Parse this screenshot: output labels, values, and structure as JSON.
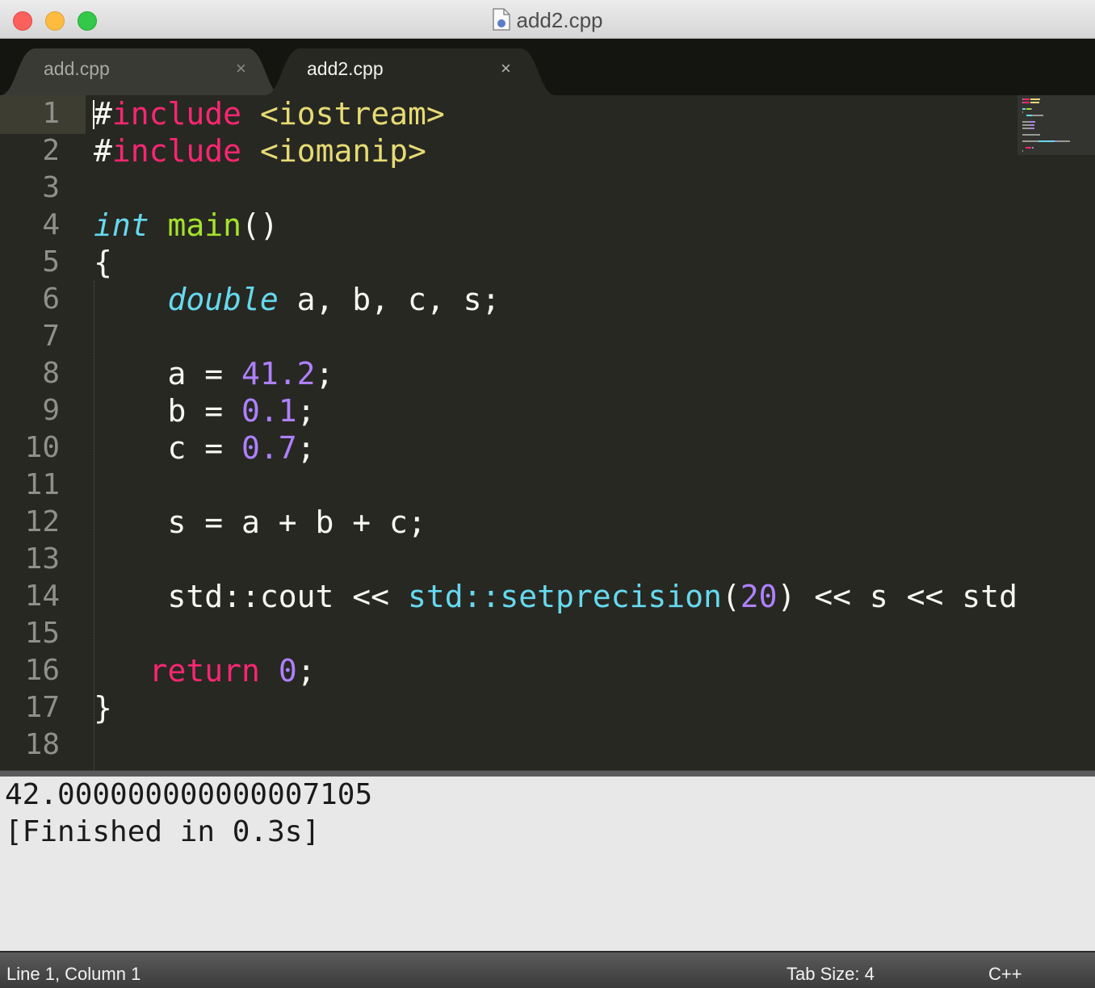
{
  "window": {
    "title": "add2.cpp"
  },
  "tabs": [
    {
      "label": "add.cpp",
      "close": "×",
      "active": false
    },
    {
      "label": "add2.cpp",
      "close": "×",
      "active": true
    }
  ],
  "editor": {
    "line_numbers": [
      "1",
      "2",
      "3",
      "4",
      "5",
      "6",
      "7",
      "8",
      "9",
      "10",
      "11",
      "12",
      "13",
      "14",
      "15",
      "16",
      "17",
      "18"
    ],
    "lines": [
      [
        {
          "t": "#",
          "c": "plain"
        },
        {
          "t": "include",
          "c": "kw"
        },
        {
          "t": " ",
          "c": "plain"
        },
        {
          "t": "<iostream>",
          "c": "str"
        }
      ],
      [
        {
          "t": "#",
          "c": "plain"
        },
        {
          "t": "include",
          "c": "kw"
        },
        {
          "t": " ",
          "c": "plain"
        },
        {
          "t": "<iomanip>",
          "c": "str"
        }
      ],
      [],
      [
        {
          "t": "int",
          "c": "type"
        },
        {
          "t": " ",
          "c": "plain"
        },
        {
          "t": "main",
          "c": "fn"
        },
        {
          "t": "()",
          "c": "plain"
        }
      ],
      [
        {
          "t": "{",
          "c": "plain"
        }
      ],
      [
        {
          "t": "    ",
          "c": "plain"
        },
        {
          "t": "double",
          "c": "type"
        },
        {
          "t": " a, b, c, s;",
          "c": "plain"
        }
      ],
      [],
      [
        {
          "t": "    a = ",
          "c": "plain"
        },
        {
          "t": "41.2",
          "c": "num"
        },
        {
          "t": ";",
          "c": "plain"
        }
      ],
      [
        {
          "t": "    b = ",
          "c": "plain"
        },
        {
          "t": "0.1",
          "c": "num"
        },
        {
          "t": ";",
          "c": "plain"
        }
      ],
      [
        {
          "t": "    c = ",
          "c": "plain"
        },
        {
          "t": "0.7",
          "c": "num"
        },
        {
          "t": ";",
          "c": "plain"
        }
      ],
      [],
      [
        {
          "t": "    s = a + b + c;",
          "c": "plain"
        }
      ],
      [],
      [
        {
          "t": "    std::cout << ",
          "c": "plain"
        },
        {
          "t": "std::setprecision",
          "c": "lib"
        },
        {
          "t": "(",
          "c": "plain"
        },
        {
          "t": "20",
          "c": "num"
        },
        {
          "t": ") << s << std",
          "c": "plain"
        }
      ],
      [],
      [
        {
          "t": "   ",
          "c": "plain"
        },
        {
          "t": "return",
          "c": "kw"
        },
        {
          "t": " ",
          "c": "plain"
        },
        {
          "t": "0",
          "c": "num"
        },
        {
          "t": ";",
          "c": "plain"
        }
      ],
      [
        {
          "t": "}",
          "c": "plain"
        }
      ],
      []
    ]
  },
  "output": {
    "lines": [
      "42.000000000000007105",
      "[Finished in 0.3s]"
    ]
  },
  "statusbar": {
    "position": "Line 1, Column 1",
    "tab_size": "Tab Size: 4",
    "syntax": "C++"
  },
  "colors": {
    "background": "#272822",
    "keyword": "#f92672",
    "string": "#e6db74",
    "type": "#66d9ef",
    "function": "#a6e22e",
    "number": "#ae81ff",
    "output_bg": "#e8e8e8"
  }
}
